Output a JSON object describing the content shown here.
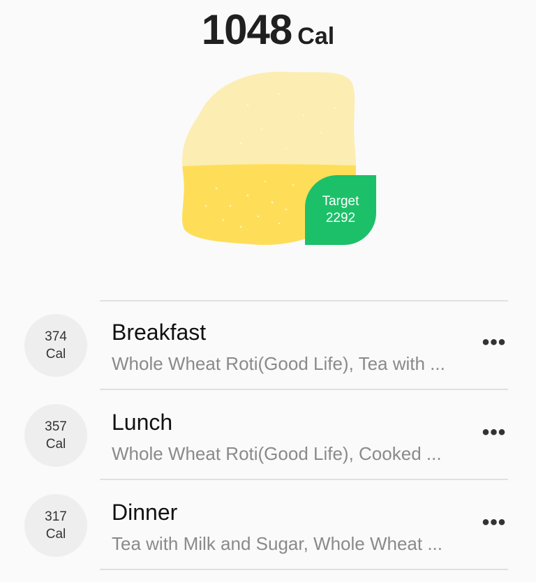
{
  "summary": {
    "total_value": "1048",
    "total_unit": "Cal",
    "target_label": "Target",
    "target_value": "2292",
    "consumed_fraction": 0.457
  },
  "meals": [
    {
      "cal_value": "374",
      "cal_unit": "Cal",
      "title": "Breakfast",
      "items": "Whole Wheat Roti(Good Life), Tea with ...",
      "more_icon": "ellipsis-icon"
    },
    {
      "cal_value": "357",
      "cal_unit": "Cal",
      "title": "Lunch",
      "items": "Whole Wheat Roti(Good Life), Cooked ...",
      "more_icon": "ellipsis-icon"
    },
    {
      "cal_value": "317",
      "cal_unit": "Cal",
      "title": "Dinner",
      "items": "Tea with Milk and Sugar, Whole Wheat ...",
      "more_icon": "ellipsis-icon"
    }
  ],
  "colors": {
    "lemon_light": "#fcedb3",
    "lemon_fill": "#fede58",
    "target_badge": "#1cc069"
  }
}
